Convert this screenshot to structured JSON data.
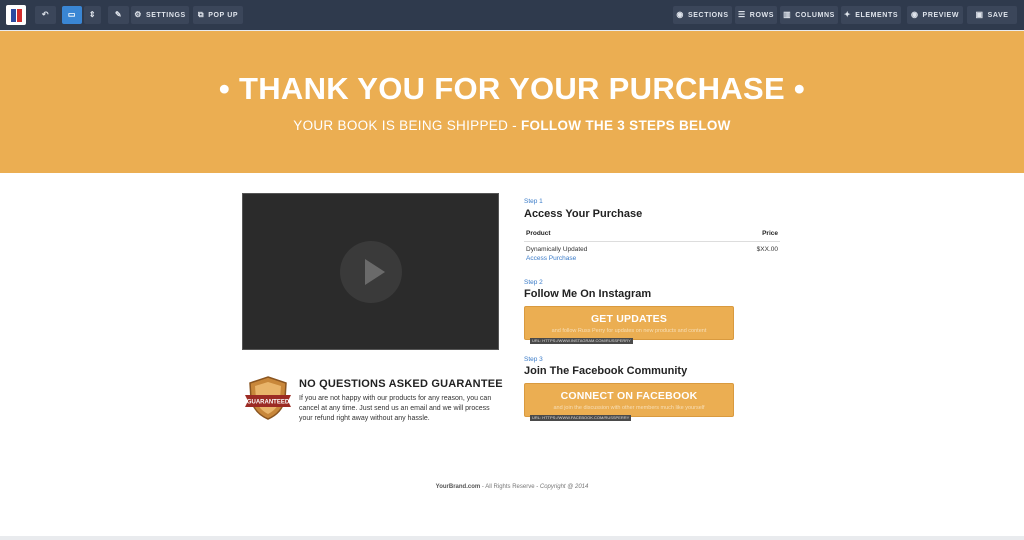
{
  "toolbar": {
    "undo_icon": "undo-icon",
    "device_icon": "desktop-icon",
    "settings_label": "SETTINGS",
    "popup_label": "POP UP",
    "sections_label": "SECTIONS",
    "rows_label": "ROWS",
    "columns_label": "COLUMNS",
    "elements_label": "ELEMENTS",
    "preview_label": "PREVIEW",
    "save_label": "SAVE"
  },
  "hero": {
    "title": "• THANK YOU FOR YOUR PURCHASE •",
    "subtitle_lead": "YOUR BOOK IS BEING SHIPPED - ",
    "subtitle_bold": "FOLLOW THE 3 STEPS BELOW",
    "bg_color": "#ebae52"
  },
  "guarantee": {
    "badge_text": "GUARANTEED",
    "title": "NO QUESTIONS ASKED GUARANTEE",
    "text": "If you are not happy with our products for any reason, you can cancel at any time. Just send us an email and we will process your refund right away without any hassle."
  },
  "steps": [
    {
      "label": "Step 1",
      "title": "Access Your Purchase"
    },
    {
      "label": "Step 2",
      "title": "Follow Me On Instagram"
    },
    {
      "label": "Step 3",
      "title": "Join The Facebook Community"
    }
  ],
  "purchase_table": {
    "col_product": "Product",
    "col_price": "Price",
    "row_product": "Dynamically Updated",
    "row_link": "Access Purchase",
    "row_price": "$XX.00"
  },
  "cta_instagram": {
    "main": "GET UPDATES",
    "sub": "and follow Russ Perry for updates on new products and content",
    "url": "URL: HTTPS://WWW.INSTAGRAM.COM/RUSSPERRY"
  },
  "cta_facebook": {
    "main": "CONNECT ON FACEBOOK",
    "sub": "and join the discussion with other members much like yourself",
    "url": "URL: HTTPS://WWW.FACEBOOK.COM/RUSSPERRY"
  },
  "footer": {
    "brand": "YourBrand.com",
    "rights": " - All Rights Reserve - ",
    "copyright": "Copyright @ 2014"
  }
}
